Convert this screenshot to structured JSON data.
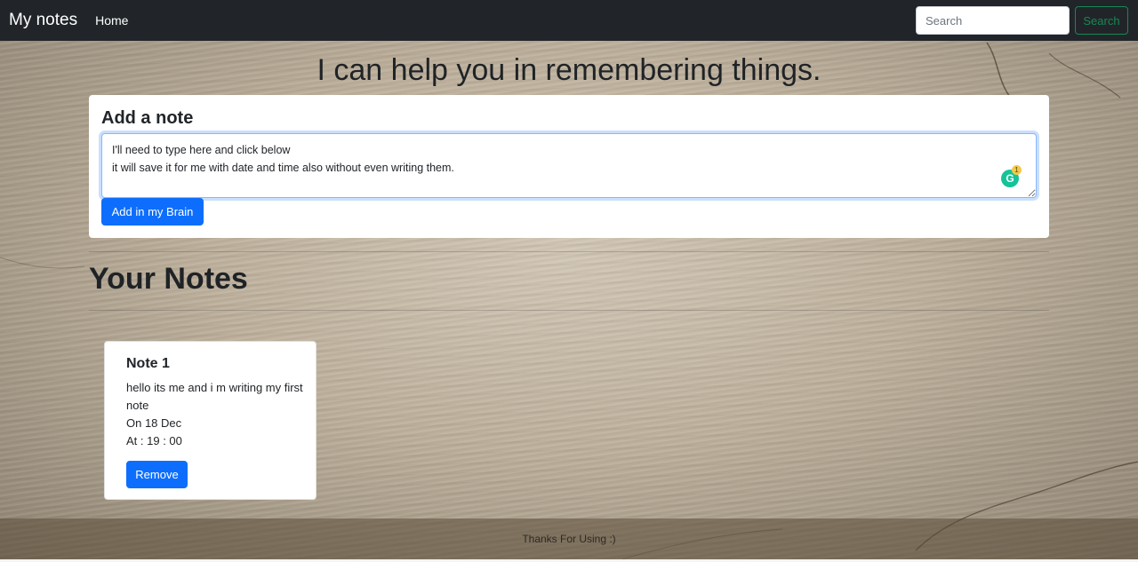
{
  "navbar": {
    "brand": "My notes",
    "home_label": "Home",
    "search_placeholder": "Search",
    "search_button": "Search"
  },
  "hero": {
    "title": "I can help you in remembering things."
  },
  "add_note": {
    "title": "Add a note",
    "textarea_value": "I'll need to type here and click below\nit will save it for me with date and time also without even writing them.",
    "grammarly_icon": "G",
    "grammarly_count": "1",
    "button_label": "Add in my Brain"
  },
  "notes_section": {
    "heading": "Your Notes",
    "notes": [
      {
        "title": "Note 1",
        "text": "hello its me and i m writing my first note",
        "date": "On 18 Dec",
        "time": "At : 19 : 00",
        "remove_label": "Remove"
      }
    ]
  },
  "footer": {
    "text": "Thanks For Using :)"
  },
  "colors": {
    "navbar_bg": "#212529",
    "primary": "#0d6efd",
    "success": "#198754",
    "grammarly": "#15c39a"
  }
}
